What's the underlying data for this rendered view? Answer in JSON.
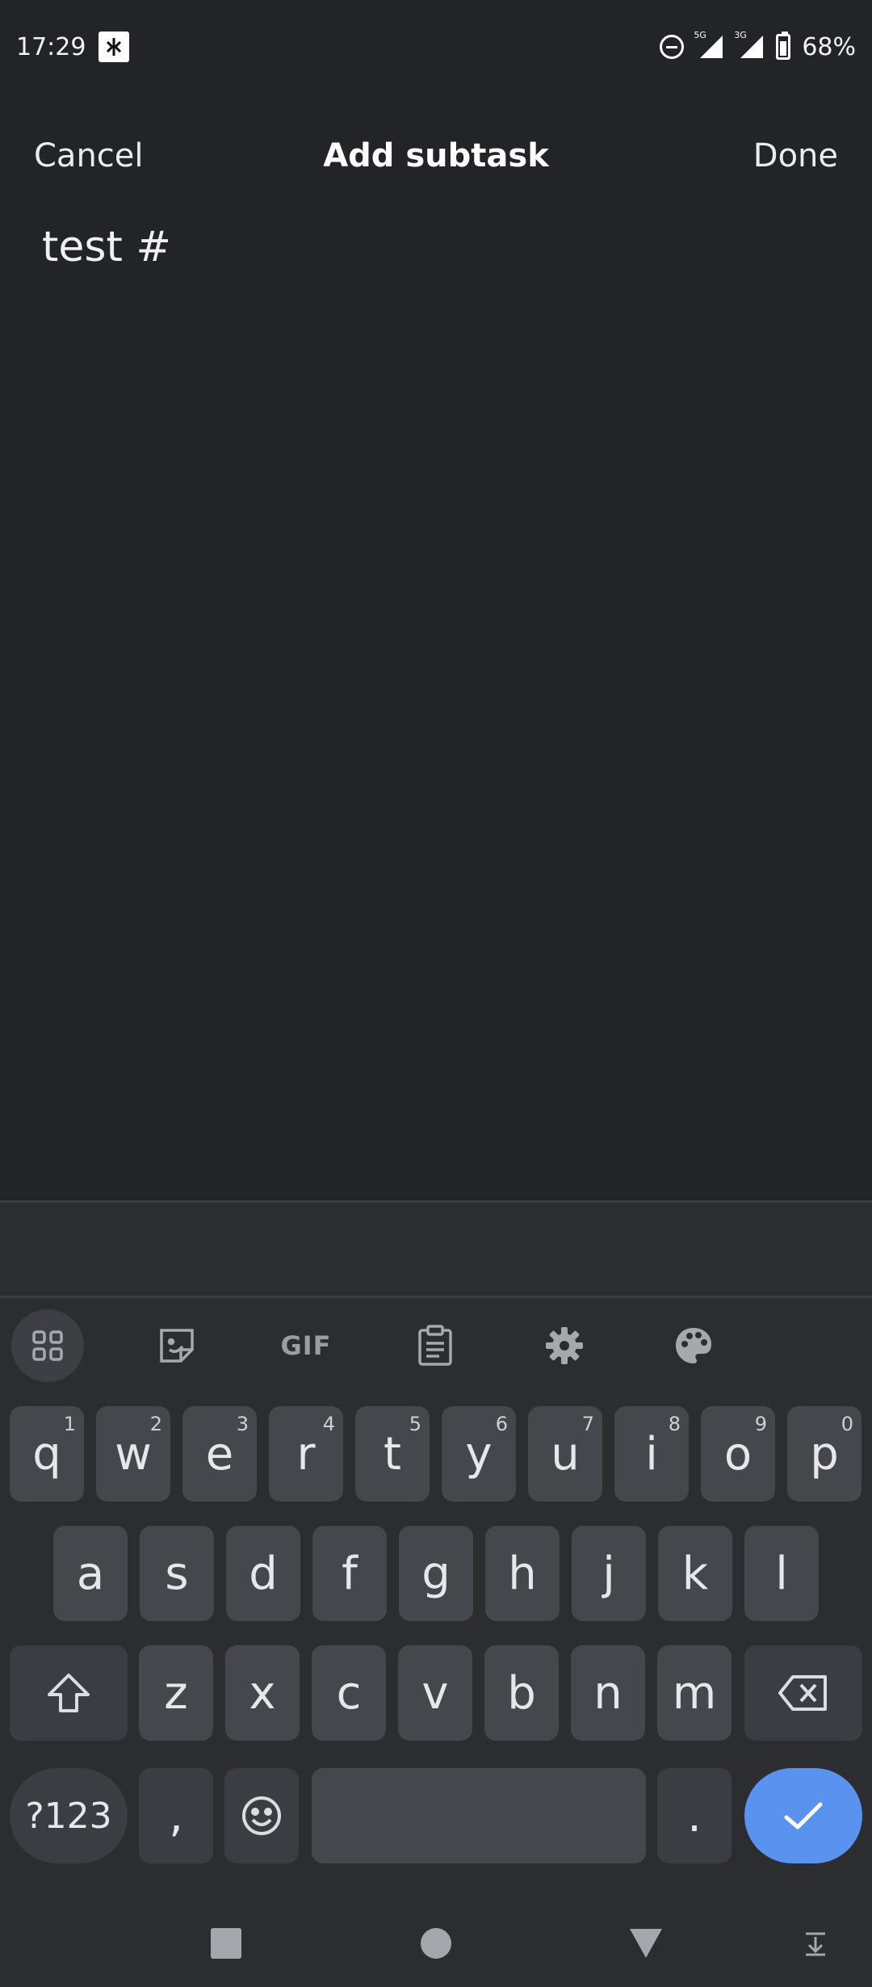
{
  "status": {
    "time": "17:29",
    "battery": "68%",
    "net_top": "5G",
    "net_second": "3G"
  },
  "app_bar": {
    "cancel": "Cancel",
    "title": "Add subtask",
    "done": "Done"
  },
  "editor": {
    "value": "test #"
  },
  "keyboard": {
    "toolbar": [
      "apps-grid-icon",
      "sticker-icon",
      "gif",
      "clipboard-icon",
      "gear-icon",
      "palette-icon"
    ],
    "gif_label": "GIF",
    "row1": [
      {
        "k": "q",
        "h": "1"
      },
      {
        "k": "w",
        "h": "2"
      },
      {
        "k": "e",
        "h": "3"
      },
      {
        "k": "r",
        "h": "4"
      },
      {
        "k": "t",
        "h": "5"
      },
      {
        "k": "y",
        "h": "6"
      },
      {
        "k": "u",
        "h": "7"
      },
      {
        "k": "i",
        "h": "8"
      },
      {
        "k": "o",
        "h": "9"
      },
      {
        "k": "p",
        "h": "0"
      }
    ],
    "row2": [
      "a",
      "s",
      "d",
      "f",
      "g",
      "h",
      "j",
      "k",
      "l"
    ],
    "row3": [
      "z",
      "x",
      "c",
      "v",
      "b",
      "n",
      "m"
    ],
    "sym_label": "?123",
    "comma": ",",
    "period": ".",
    "accent_color": "#5a92f0"
  }
}
